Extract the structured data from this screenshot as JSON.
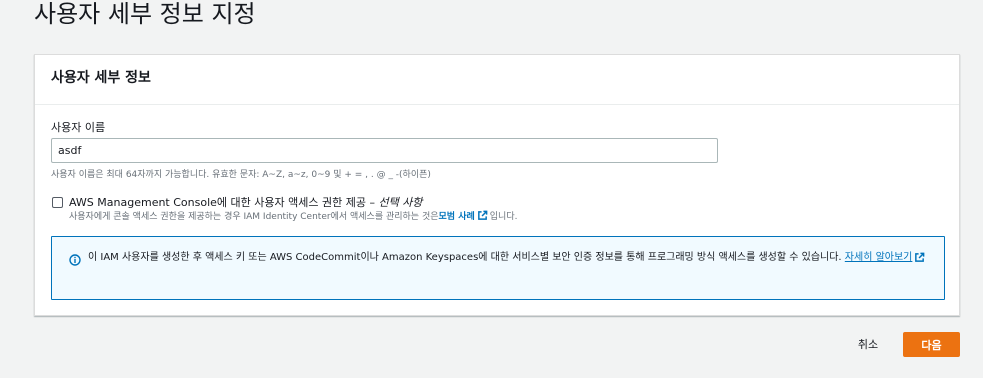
{
  "page": {
    "title": "사용자 세부 정보 지정"
  },
  "panel": {
    "title": "사용자 세부 정보",
    "username": {
      "label": "사용자 이름",
      "value": "asdf",
      "hint": "사용자 이름은 최대 64자까지 가능합니다. 유효한 문자: A~Z, a~z, 0~9 및 + = , . @ _ -(하이픈)"
    },
    "console_access": {
      "label": "AWS Management Console에 대한 사용자 액세스 권한 제공 – ",
      "optional": "선택 사항",
      "checked": false,
      "desc_before": "사용자에게 콘솔 액세스 권한을 제공하는 경우 IAM Identity Center에서 액세스를 관리하는 것은 ",
      "desc_link": "모범 사례",
      "desc_after": "입니다.",
      "link_icon": "external-link-icon"
    },
    "info": {
      "icon": "info-icon",
      "text": "이 IAM 사용자를 생성한 후 액세스 키 또는 AWS CodeCommit이나 Amazon Keyspaces에 대한 서비스별 보안 인증 정보를 통해 프로그래밍 방식 액세스를 생성할 수 있습니다. ",
      "link": "자세히 알아보기",
      "link_icon": "external-link-icon",
      "accent": "#0073bb"
    }
  },
  "footer": {
    "cancel_label": "취소",
    "next_label": "다음",
    "next_color": "#ec7211"
  }
}
